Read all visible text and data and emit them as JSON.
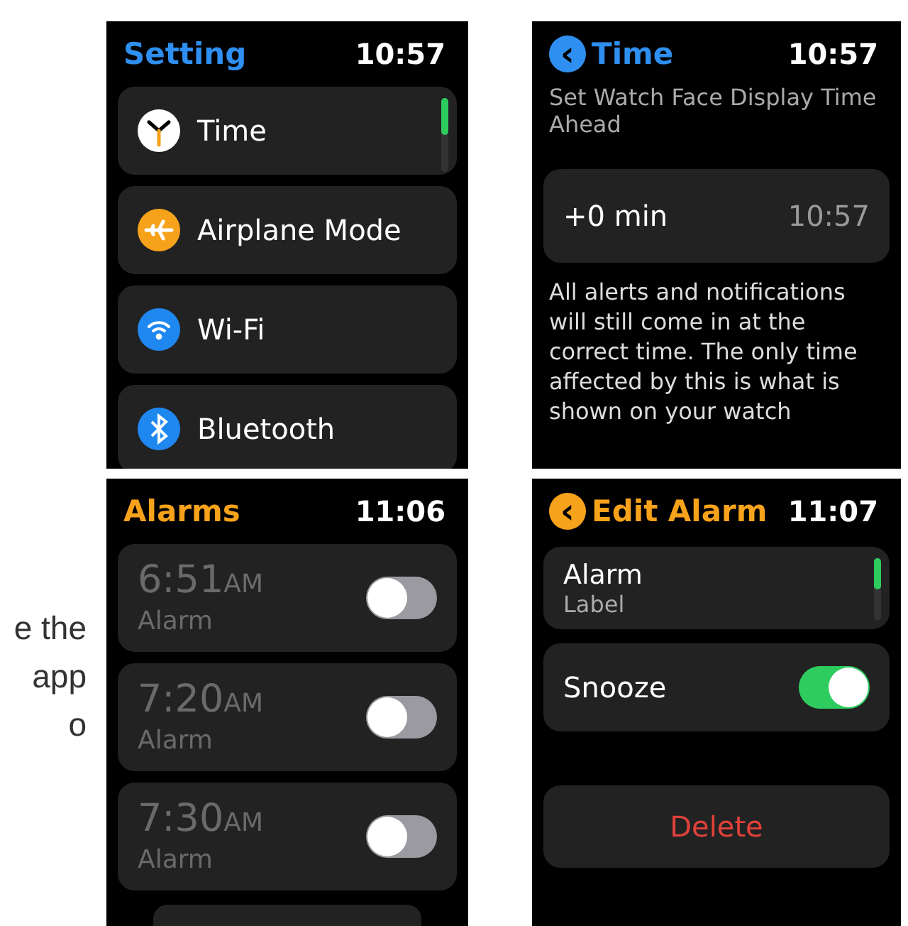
{
  "side_text": [
    "e the",
    "app",
    "o"
  ],
  "settings_screen": {
    "title": "Setting",
    "time": "10:57",
    "items": [
      {
        "label": "Time",
        "kind": "clock"
      },
      {
        "label": "Airplane Mode",
        "kind": "airplane"
      },
      {
        "label": "Wi-Fi",
        "kind": "wifi"
      },
      {
        "label": "Bluetooth",
        "kind": "bluetooth"
      }
    ]
  },
  "time_screen": {
    "back": "‹",
    "title": "Time",
    "time": "10:57",
    "subtitle": "Set Watch Face Display Time Ahead",
    "offset": "+0 min",
    "display_time": "10:57",
    "note": "All alerts and notifications will still come in at the correct time. The only time affected by this is what is shown on your watch"
  },
  "alarms_screen": {
    "title": "Alarms",
    "time": "11:06",
    "alarms": [
      {
        "time": "6:51",
        "period": "AM",
        "label": "Alarm",
        "on": false
      },
      {
        "time": "7:20",
        "period": "AM",
        "label": "Alarm",
        "on": false
      },
      {
        "time": "7:30",
        "period": "AM",
        "label": "Alarm",
        "on": false
      }
    ]
  },
  "edit_alarm_screen": {
    "back": "‹",
    "title": "Edit Alarm",
    "time": "11:07",
    "label_title": "Alarm",
    "label_caption": "Label",
    "snooze": {
      "label": "Snooze",
      "on": true
    },
    "delete": "Delete"
  }
}
